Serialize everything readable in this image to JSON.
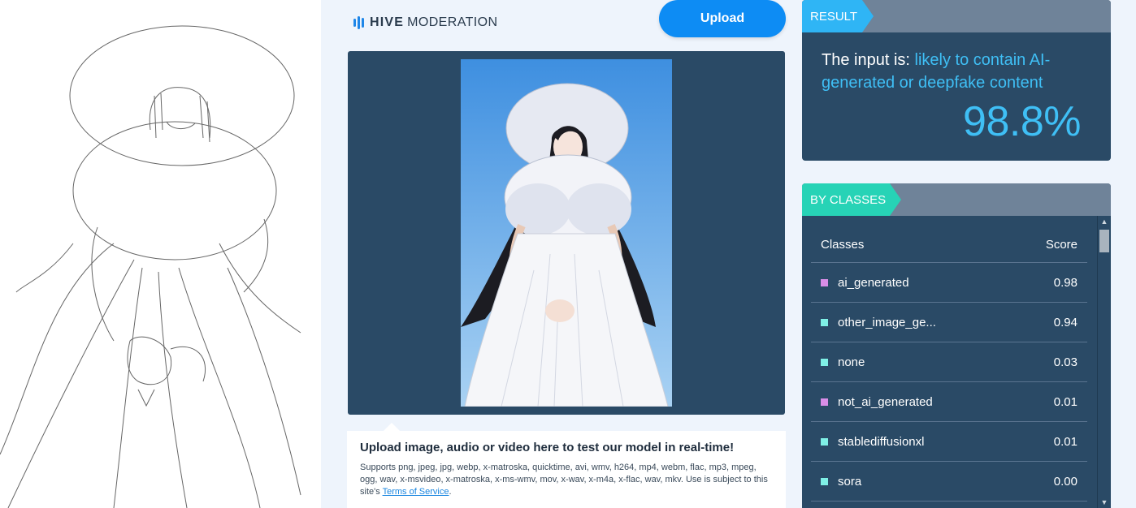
{
  "logo": {
    "brand": "HIVE",
    "product": "MODERATION"
  },
  "upload_label": "Upload",
  "info": {
    "title": "Upload image, audio or video here to test our model in real-time!",
    "body": "Supports png, jpeg, jpg, webp, x-matroska, quicktime, avi, wmv, h264, mp4, webm, flac, mp3, mpeg, ogg, wav, x-msvideo, x-matroska, x-ms-wmv, mov, x-wav, x-m4a, x-flac, wav, mkv. Use is subject to this site's",
    "link": "Terms of Service",
    "tail": "."
  },
  "result": {
    "tag": "RESULT",
    "prefix": "The input is:",
    "verdict": "likely to contain AI-generated or deepfake content",
    "percent": "98.8%"
  },
  "classes": {
    "tag": "BY CLASSES",
    "col_class": "Classes",
    "col_score": "Score",
    "rows": [
      {
        "name": "ai_generated",
        "score": "0.98",
        "color": "#d98ee8"
      },
      {
        "name": "other_image_ge...",
        "score": "0.94",
        "color": "#7ff0e6"
      },
      {
        "name": "none",
        "score": "0.03",
        "color": "#7ff0e6"
      },
      {
        "name": "not_ai_generated",
        "score": "0.01",
        "color": "#d98ee8"
      },
      {
        "name": "stablediffusionxl",
        "score": "0.01",
        "color": "#7ff0e6"
      },
      {
        "name": "sora",
        "score": "0.00",
        "color": "#7ff0e6"
      }
    ]
  },
  "colors": {
    "accent_blue": "#2fb5f5",
    "accent_green": "#27d3b6",
    "card_bg": "#2a4a66",
    "upload_btn": "#0d8cf4"
  },
  "icons": {
    "logo": "hive-bars-icon",
    "scroll_up": "scroll-up-arrow-icon",
    "scroll_down": "scroll-down-arrow-icon"
  }
}
